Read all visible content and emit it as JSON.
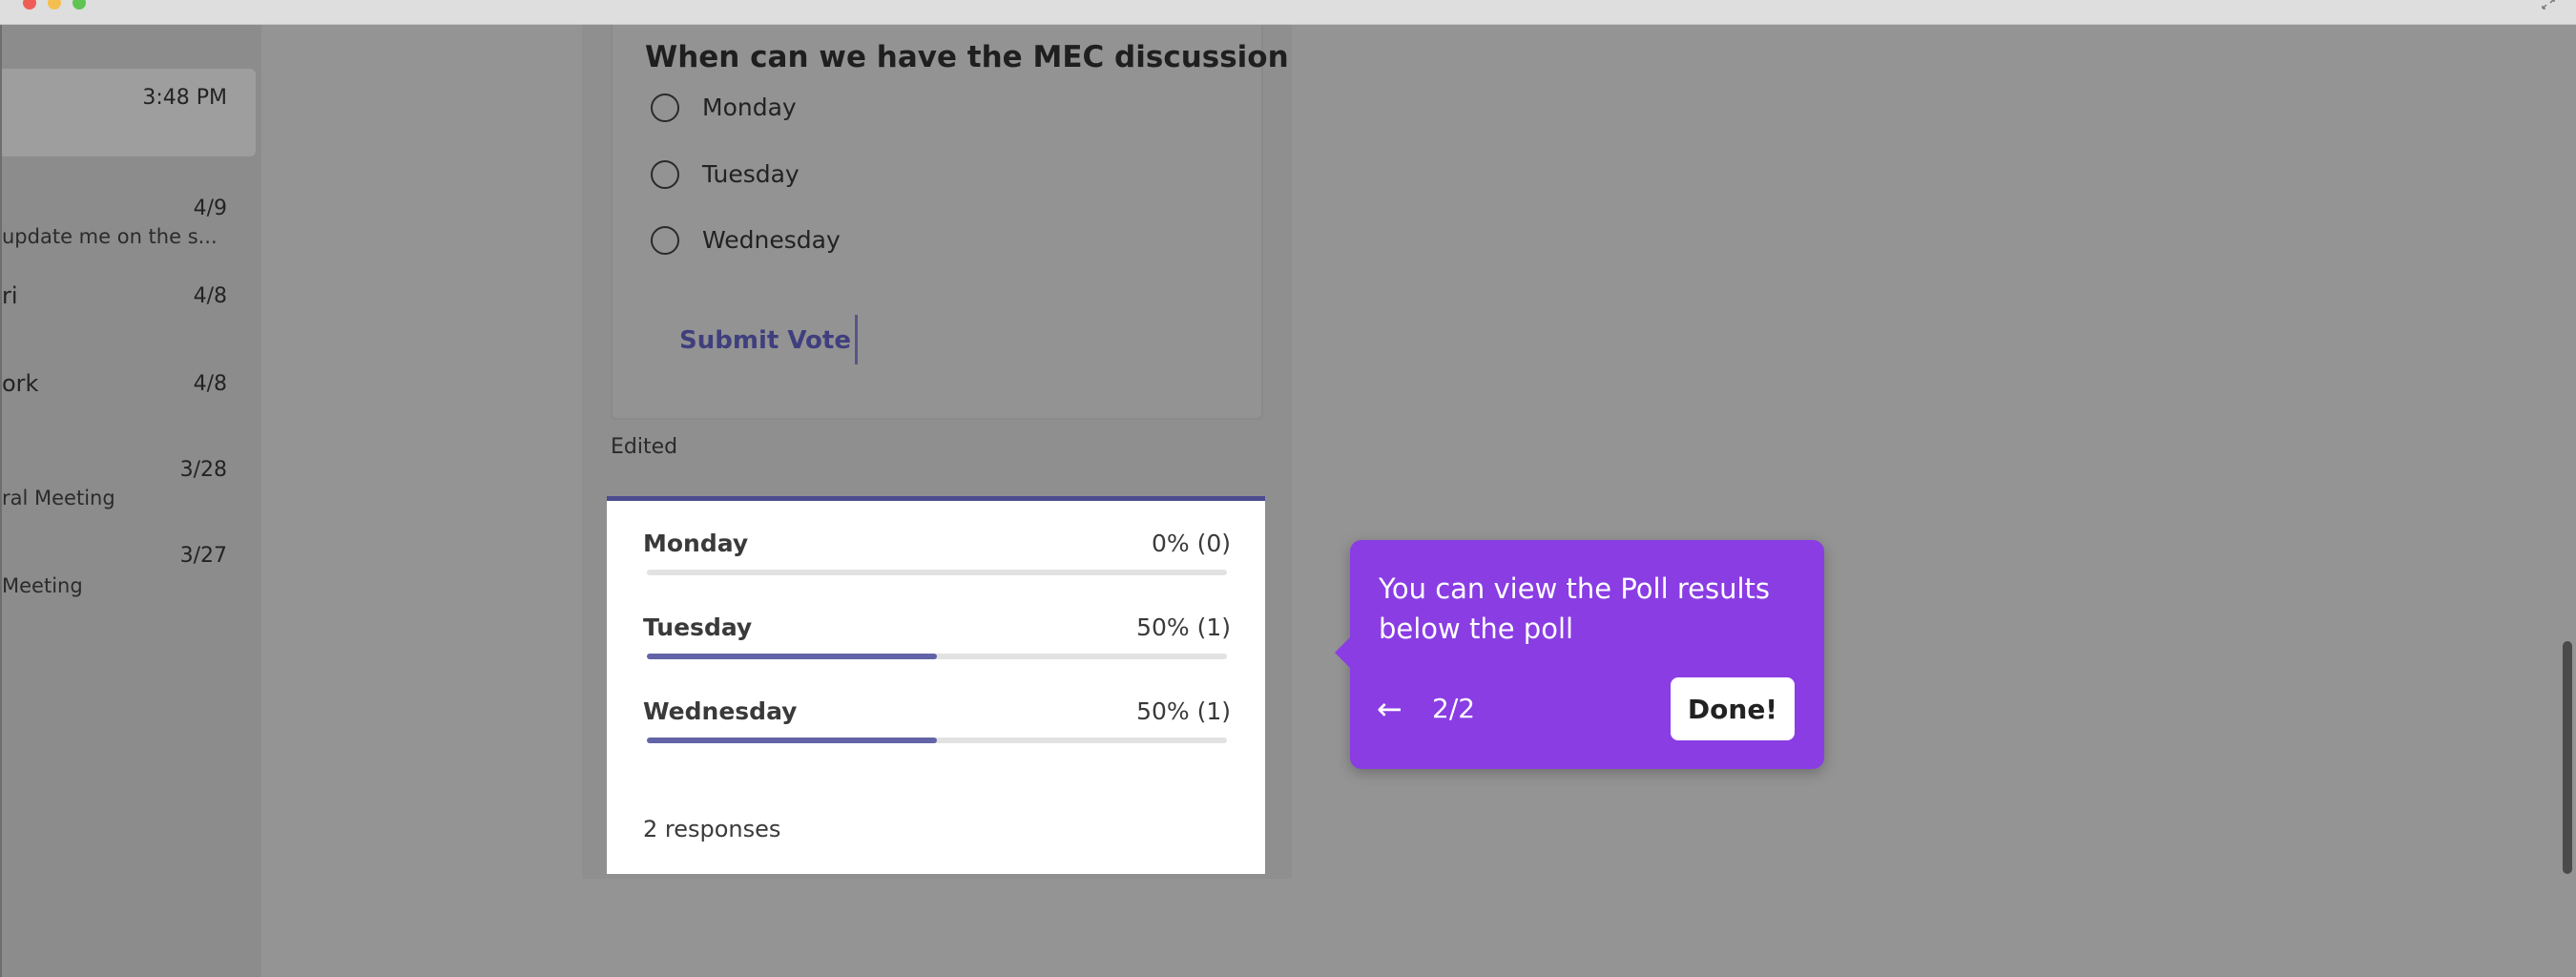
{
  "chat_list": [
    {
      "time": "3:48 PM",
      "name": "",
      "preview": ""
    },
    {
      "time": "4/9",
      "name": "",
      "preview": "update me on the s..."
    },
    {
      "time": "4/8",
      "name": "ri",
      "preview": ""
    },
    {
      "time": "4/8",
      "name": "ork",
      "preview": ""
    },
    {
      "time": "3/28",
      "name": "",
      "preview": "ral Meeting"
    },
    {
      "time": "3/27",
      "name": "",
      "preview": "Meeting"
    }
  ],
  "poll": {
    "question": "When can we have the MEC discussion",
    "options": [
      "Monday",
      "Tuesday",
      "Wednesday"
    ],
    "submit_label": "Submit Vote"
  },
  "edited_label": "Edited",
  "results": {
    "rows": [
      {
        "label": "Monday",
        "value": "0% (0)",
        "fraction": 0
      },
      {
        "label": "Tuesday",
        "value": "50% (1)",
        "fraction": 0.5
      },
      {
        "label": "Wednesday",
        "value": "50% (1)",
        "fraction": 0.5
      }
    ],
    "responses": "2 responses",
    "bar_color": "#6264a7"
  },
  "tour": {
    "text": "You can view the Poll results below the poll",
    "back_icon": "arrow-left-icon",
    "step": "2/2",
    "done_label": "Done!",
    "color": "#8a3de3"
  }
}
